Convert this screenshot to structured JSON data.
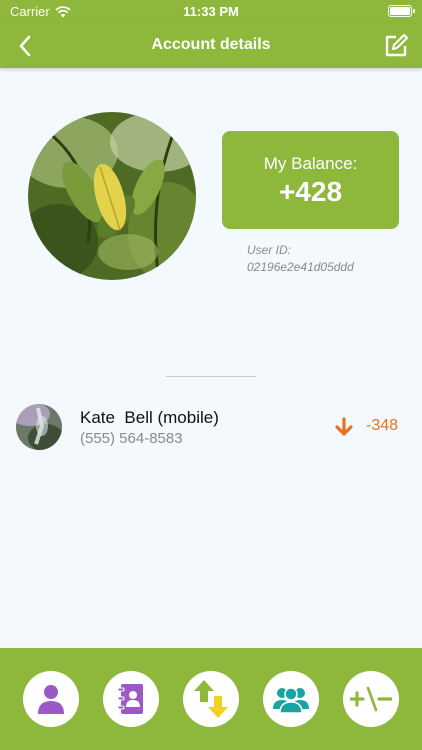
{
  "status_bar": {
    "carrier": "Carrier",
    "time": "11:33 PM"
  },
  "nav": {
    "title": "Account details",
    "back_icon": "chevron-left-icon",
    "edit_icon": "edit-icon"
  },
  "balance": {
    "label": "My Balance:",
    "value": "+428"
  },
  "user_id": {
    "label": "User ID:",
    "value": "02196e2e41d05ddd"
  },
  "transactions": [
    {
      "name": "Kate  Bell (mobile)",
      "phone": "(555) 564-8583",
      "direction": "down",
      "amount": "-348"
    }
  ],
  "colors": {
    "brand_green": "#8db83c",
    "debit_orange": "#e8711f",
    "purple": "#9b59c6",
    "teal": "#1aa3a3",
    "yellow": "#f2d31b"
  },
  "tab_bar": [
    {
      "icon": "person-icon"
    },
    {
      "icon": "address-book-icon"
    },
    {
      "icon": "transfer-arrows-icon"
    },
    {
      "icon": "group-icon"
    },
    {
      "icon": "plus-minus-icon"
    }
  ]
}
